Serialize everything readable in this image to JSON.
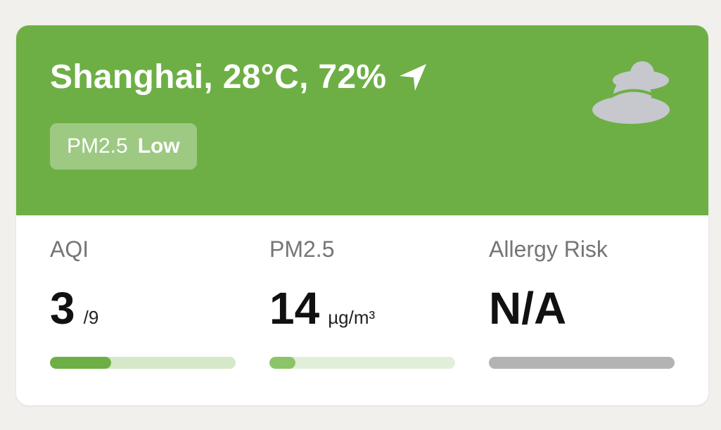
{
  "header": {
    "title": "Shanghai, 28°C, 72%",
    "location_icon": "navigation-arrow-icon",
    "weather_icon": "cloudy-icon",
    "badge": {
      "label": "PM2.5",
      "value": "Low"
    },
    "background_color": "#6daf45"
  },
  "stats": [
    {
      "label": "AQI",
      "value": "3",
      "unit": "/9",
      "progress": 0.33,
      "fill_color": "#6daf45",
      "track_color": "#d5e8c8"
    },
    {
      "label": "PM2.5",
      "value": "14",
      "unit": "µg/m³",
      "progress": 0.14,
      "fill_color": "#8cc46a",
      "track_color": "#e2efd8"
    },
    {
      "label": "Allergy Risk",
      "value": "N/A",
      "unit": "",
      "progress": 1.0,
      "fill_color": "#b3b3b3",
      "track_color": "#b3b3b3"
    }
  ]
}
